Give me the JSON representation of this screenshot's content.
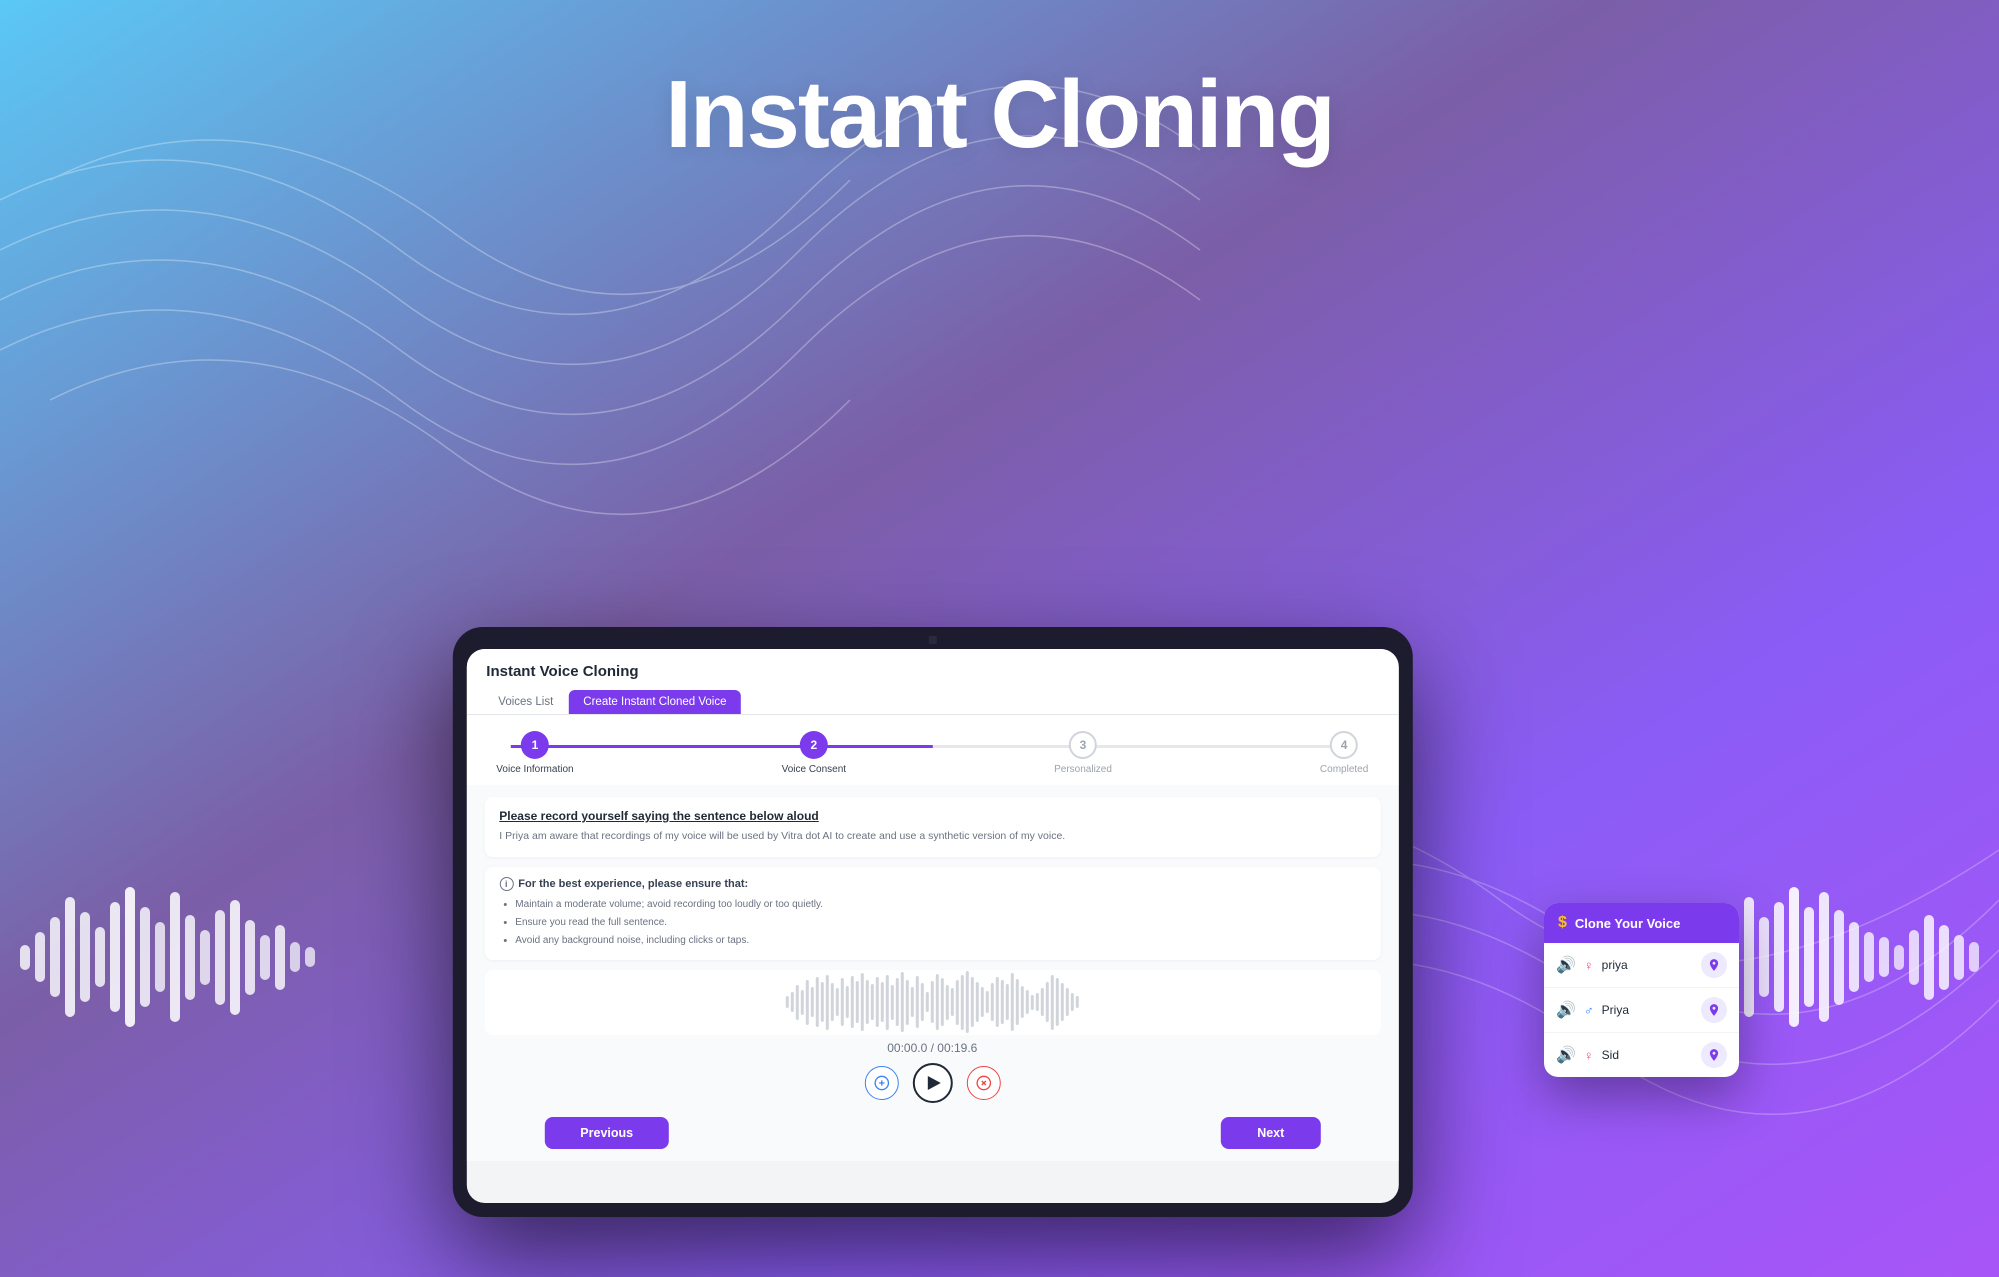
{
  "page": {
    "title": "Instant Cloning",
    "background": {
      "gradientStart": "#5bc8f5",
      "gradientEnd": "#a855f7"
    }
  },
  "app": {
    "title": "Instant Voice Cloning",
    "tabs": [
      {
        "label": "Voices List",
        "active": false
      },
      {
        "label": "Create Instant Cloned Voice",
        "active": true
      }
    ],
    "steps": [
      {
        "number": "1",
        "label": "Voice Information",
        "state": "completed"
      },
      {
        "number": "2",
        "label": "Voice Consent",
        "state": "completed"
      },
      {
        "number": "3",
        "label": "Personalized",
        "state": "inactive"
      },
      {
        "number": "4",
        "label": "Completed",
        "state": "inactive"
      }
    ],
    "instruction": {
      "title": "Please record yourself saying the sentence below aloud",
      "text": "I Priya am aware that recordings of my voice will be used by Vitra dot AI to create and use a synthetic version of my voice."
    },
    "tips": {
      "header": "For the best experience, please ensure that:",
      "items": [
        "Maintain a moderate volume; avoid recording too loudly or too quietly.",
        "Ensure you read the full sentence.",
        "Avoid any background noise, including clicks or taps."
      ]
    },
    "timer": {
      "current": "00:00.0",
      "total": "00:19.6",
      "display": "00:00.0 / 00:19.6"
    },
    "controls": {
      "rewind": "⊕",
      "play": "▶",
      "close": "⊗"
    },
    "navigation": {
      "previous": "Previous",
      "next": "Next"
    }
  },
  "cloneCard": {
    "title": "Clone Your Voice",
    "voices": [
      {
        "name": "priya",
        "gender": "female"
      },
      {
        "name": "Priya",
        "gender": "male"
      },
      {
        "name": "Sid",
        "gender": "female"
      }
    ]
  }
}
